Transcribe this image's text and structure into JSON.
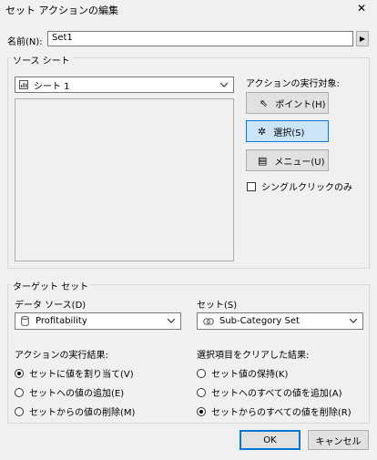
{
  "window": {
    "title": "セット アクションの編集"
  },
  "name": {
    "label": "名前(N):",
    "value": "Set1"
  },
  "source": {
    "legend": "ソース シート",
    "sheet_selected": "シート 1",
    "run_on_label": "アクションの実行対象:",
    "buttons": {
      "point": "ポイント(H)",
      "select": "選択(S)",
      "menu": "メニュー(U)"
    },
    "single_click_label": "シングルクリックのみ"
  },
  "target": {
    "legend": "ターゲット セット",
    "datasource_label": "データ ソース(D)",
    "datasource_value": "Profitability",
    "set_label": "セット(S)",
    "set_value": "Sub-Category Set"
  },
  "result": {
    "label": "アクションの実行結果:",
    "options": [
      "セットに値を割り当て(V)",
      "セットへの値の追加(E)",
      "セットからの値の削除(M)"
    ]
  },
  "clear": {
    "label": "選択項目をクリアした結果:",
    "options": [
      "セット値の保持(K)",
      "セットへのすべての値を追加(A)",
      "セットからのすべての値を削除(R)"
    ]
  },
  "footer": {
    "ok": "OK",
    "cancel": "キャンセル"
  }
}
